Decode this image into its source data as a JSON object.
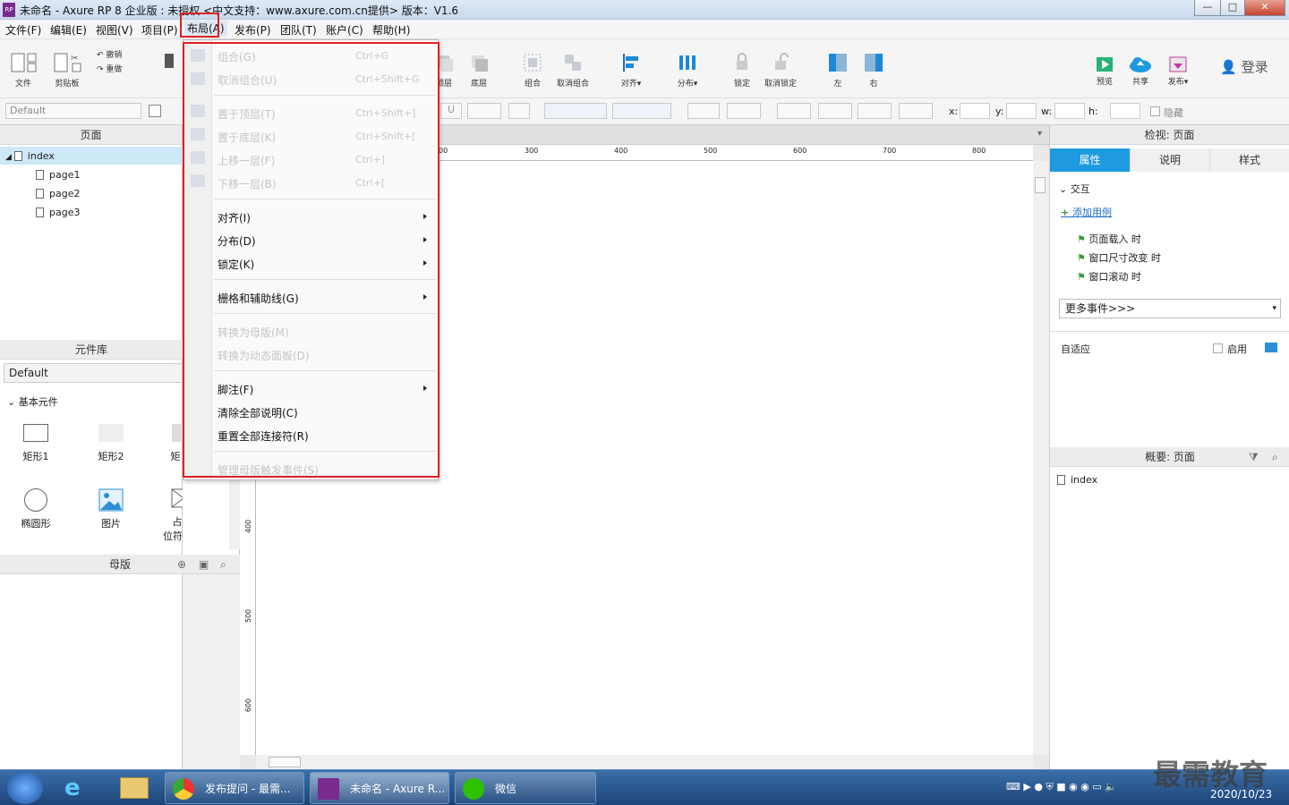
{
  "window": {
    "title": "未命名 - Axure RP 8 企业版 : 未授权     <中文支持：www.axure.com.cn提供> 版本：V1.6",
    "logo_text": "RP",
    "minimize": "—",
    "maximize": "□",
    "close": "✕"
  },
  "menubar": [
    "文件(F)",
    "编辑(E)",
    "视图(V)",
    "项目(P)",
    "布局(A)",
    "发布(P)",
    "团队(T)",
    "账户(C)",
    "帮助(H)"
  ],
  "toolbar": {
    "file": "文件",
    "clipboard": "剪贴板",
    "undo": "撤销",
    "redo": "重做",
    "top_layer": "顶层",
    "bottom_layer": "底层",
    "group": "组合",
    "ungroup": "取消组合",
    "align": "对齐▾",
    "distribute": "分布▾",
    "lock": "锁定",
    "unlock": "取消锁定",
    "left": "左",
    "right": "右",
    "preview": "预览",
    "share": "共享",
    "publish": "发布▾",
    "login": "登录"
  },
  "format_bar": {
    "style_select": "Default",
    "x_label": "x:",
    "y_label": "y:",
    "w_label": "w:",
    "h_label": "h:",
    "hidden_label": "隐藏"
  },
  "pages_panel": {
    "title": "页面",
    "items": [
      {
        "label": "index",
        "level": 0
      },
      {
        "label": "page1",
        "level": 1
      },
      {
        "label": "page2",
        "level": 1
      },
      {
        "label": "page3",
        "level": 1
      }
    ]
  },
  "library_panel": {
    "title": "元件库",
    "selected_library": "Default",
    "section": "基本元件",
    "widgets": [
      "矩形1",
      "矩形2",
      "矩",
      "椭圆形",
      "图片",
      "占位符"
    ]
  },
  "masters_panel": {
    "title": "母版"
  },
  "ruler": {
    "top_ticks": [
      "00",
      "300",
      "400",
      "500",
      "600",
      "700",
      "800"
    ],
    "left_ticks": [
      "400",
      "500",
      "600"
    ]
  },
  "layout_menu": {
    "items": [
      {
        "label": "组合(G)",
        "shortcut": "Ctrl+G",
        "disabled": true
      },
      {
        "label": "取消组合(U)",
        "shortcut": "Ctrl+Shift+G",
        "disabled": true
      },
      {
        "label": "置于顶层(T)",
        "shortcut": "Ctrl+Shift+]",
        "disabled": true
      },
      {
        "label": "置于底层(K)",
        "shortcut": "Ctrl+Shift+[",
        "disabled": true
      },
      {
        "label": "上移一层(F)",
        "shortcut": "Ctrl+]",
        "disabled": true
      },
      {
        "label": "下移一层(B)",
        "shortcut": "Ctrl+[",
        "disabled": true
      },
      {
        "label": "对齐(I)",
        "submenu": true
      },
      {
        "label": "分布(D)",
        "submenu": true
      },
      {
        "label": "锁定(K)",
        "submenu": true
      },
      {
        "label": "栅格和辅助线(G)",
        "submenu": true
      },
      {
        "label": "转换为母版(M)",
        "disabled": true
      },
      {
        "label": "转换为动态面板(D)",
        "disabled": true
      },
      {
        "label": "脚注(F)",
        "submenu": true
      },
      {
        "label": "清除全部说明(C)"
      },
      {
        "label": "重置全部连接符(R)"
      },
      {
        "label": "管理母版触发事件(S)",
        "disabled": true
      }
    ]
  },
  "inspector": {
    "title": "检视: 页面",
    "tabs": [
      "属性",
      "说明",
      "样式"
    ],
    "active_tab": "属性",
    "section_interaction": "交互",
    "add_case": "添加用例",
    "events": [
      "页面载入 时",
      "窗口尺寸改变 时",
      "窗口滚动 时"
    ],
    "more_events": "更多事件>>>",
    "adaptive_label": "自适应",
    "enable_label": "启用"
  },
  "outline_panel": {
    "title": "概要: 页面",
    "items": [
      "index"
    ]
  },
  "taskbar": {
    "tasks": [
      "发布提问 - 最需...",
      "未命名 - Axure R...",
      "微信"
    ],
    "clock_date": "2020/10/23",
    "watermark": "最需教育"
  },
  "colors": {
    "accent": "#1e9be0",
    "highlight_red": "#e02020",
    "selected_row": "#cde8f7"
  }
}
